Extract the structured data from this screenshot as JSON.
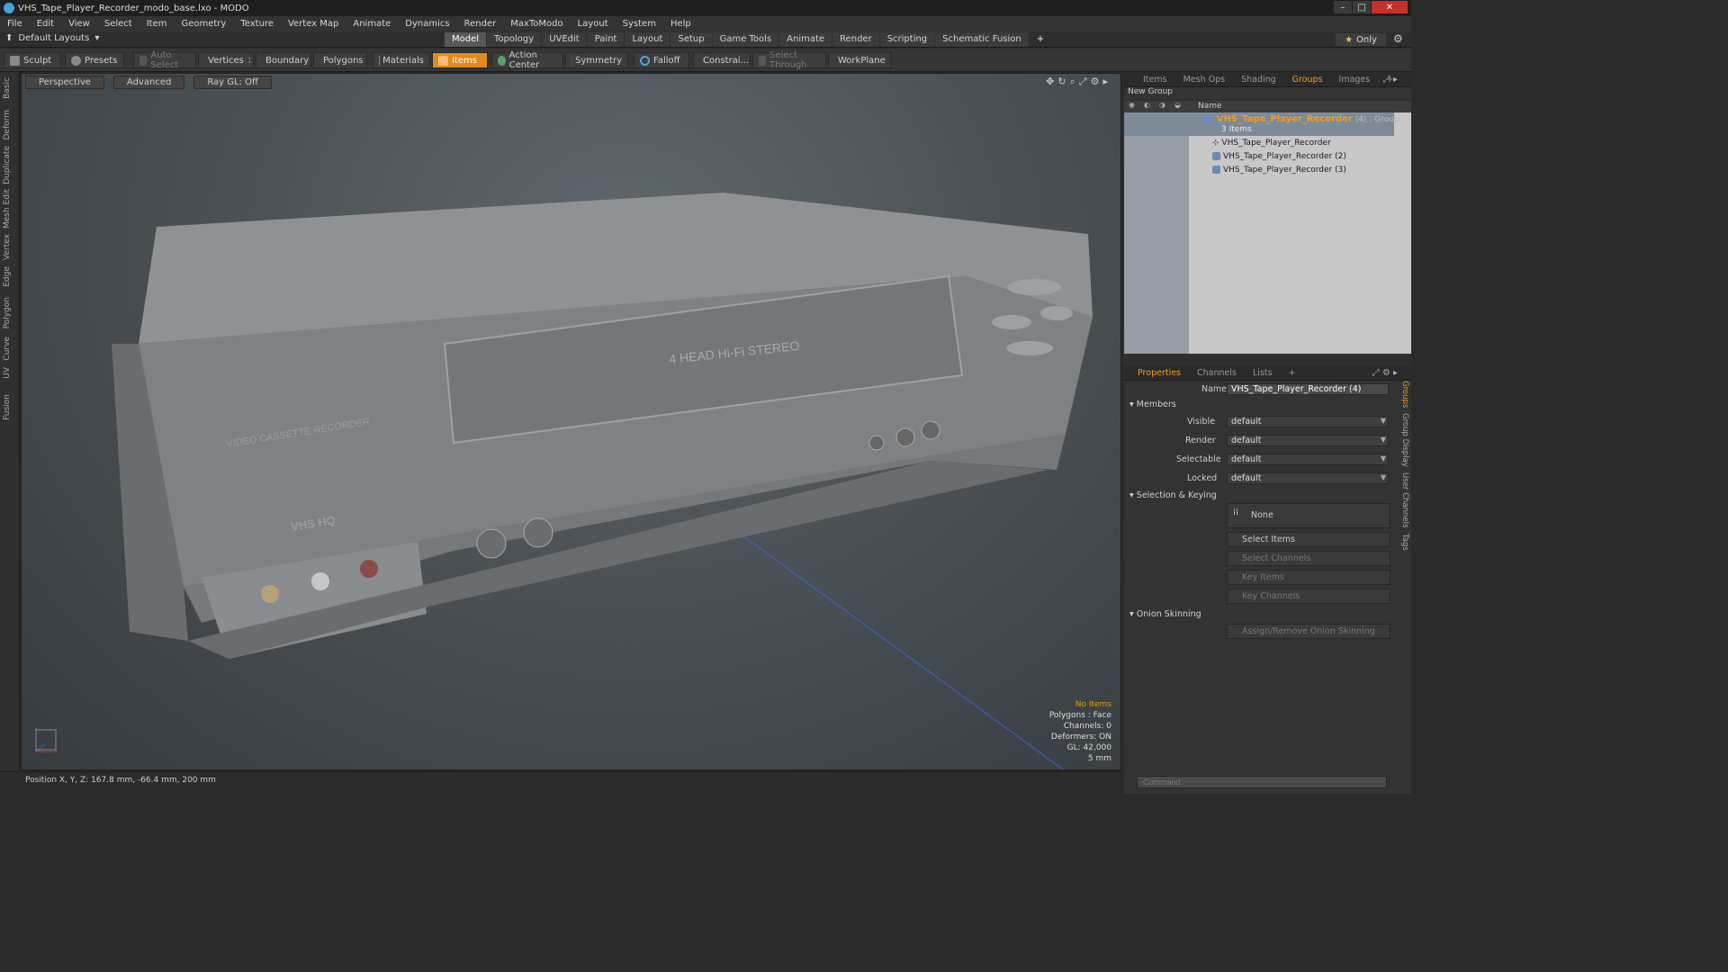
{
  "window": {
    "title": "VHS_Tape_Player_Recorder_modo_base.lxo - MODO"
  },
  "menu": [
    "File",
    "Edit",
    "View",
    "Select",
    "Item",
    "Geometry",
    "Texture",
    "Vertex Map",
    "Animate",
    "Dynamics",
    "Render",
    "MaxToModo",
    "Layout",
    "System",
    "Help"
  ],
  "layout_bar": {
    "dropdown": "Default Layouts",
    "tabs": [
      "Model",
      "Topology",
      "UVEdit",
      "Paint",
      "Layout",
      "Setup",
      "Game Tools",
      "Animate",
      "Render",
      "Scripting",
      "Schematic Fusion"
    ],
    "active_tab": "Model",
    "only_label": "Only"
  },
  "toolbar": {
    "sculpt": "Sculpt",
    "presets": "Presets",
    "auto_select": "Auto Select",
    "vertices": "Vertices",
    "vertices_count": "1",
    "boundary": "Boundary",
    "polygons": "Polygons",
    "materials": "Materials",
    "items": "Items",
    "action_center": "Action Center",
    "symmetry": "Symmetry",
    "falloff": "Falloff",
    "constraints": "Constrai...",
    "select_through": "Select Through",
    "workplane": "WorkPlane"
  },
  "left_tabs": [
    "Basic",
    "Deform",
    "Duplicate",
    "Mesh Edit",
    "Vertex",
    "Edge",
    "Polygon",
    "Curve",
    "UV",
    "Fusion"
  ],
  "viewport": {
    "buttons": [
      "Perspective",
      "Advanced",
      "Ray GL: Off"
    ],
    "model_text": {
      "head": "4 HEAD Hi-Fi STEREO",
      "vcr": "VIDEO CASSETTE RECORDER",
      "brand": "VHS HQ"
    },
    "stats": {
      "items": "No Items",
      "polygons": "Polygons : Face",
      "channels": "Channels: 0",
      "deformers": "Deformers: ON",
      "gl": "GL: 42,000",
      "unit": "5 mm"
    }
  },
  "status": {
    "position": "Position X, Y, Z:   167.8 mm, -66.4 mm, 200 mm"
  },
  "top_panel": {
    "tabs": [
      "Items",
      "Mesh Ops",
      "Shading",
      "Groups",
      "Images"
    ],
    "active_tab": "Groups",
    "new_group": "New Group",
    "column": "Name",
    "group": {
      "name": "VHS_Tape_Player_Recorder",
      "suffix": "(4) : Group",
      "count": "3 Items"
    },
    "children": [
      "VHS_Tape_Player_Recorder",
      "VHS_Tape_Player_Recorder (2)",
      "VHS_Tape_Player_Recorder (3)"
    ]
  },
  "bottom_panel": {
    "tabs": [
      "Properties",
      "Channels",
      "Lists"
    ],
    "active_tab": "Properties",
    "name_label": "Name",
    "name_value": "VHS_Tape_Player_Recorder (4)",
    "members_label": "Members",
    "fields": [
      {
        "label": "Visible",
        "value": "default"
      },
      {
        "label": "Render",
        "value": "default"
      },
      {
        "label": "Selectable",
        "value": "default"
      },
      {
        "label": "Locked",
        "value": "default"
      }
    ],
    "selection_keying": "Selection & Keying",
    "none_label": "None",
    "buttons": [
      "Select Items",
      "Select Channels",
      "Key Items",
      "Key Channels"
    ],
    "onion": "Onion Skinning",
    "onion_button": "Assign/Remove Onion Skinning",
    "side_tabs": [
      "Groups",
      "Group Display",
      "User Channels",
      "Tags"
    ],
    "command_placeholder": "Command"
  },
  "colors": {
    "accent": "#f09c20",
    "items_active": "#e08a1e",
    "bg": "#2b2b2b"
  }
}
